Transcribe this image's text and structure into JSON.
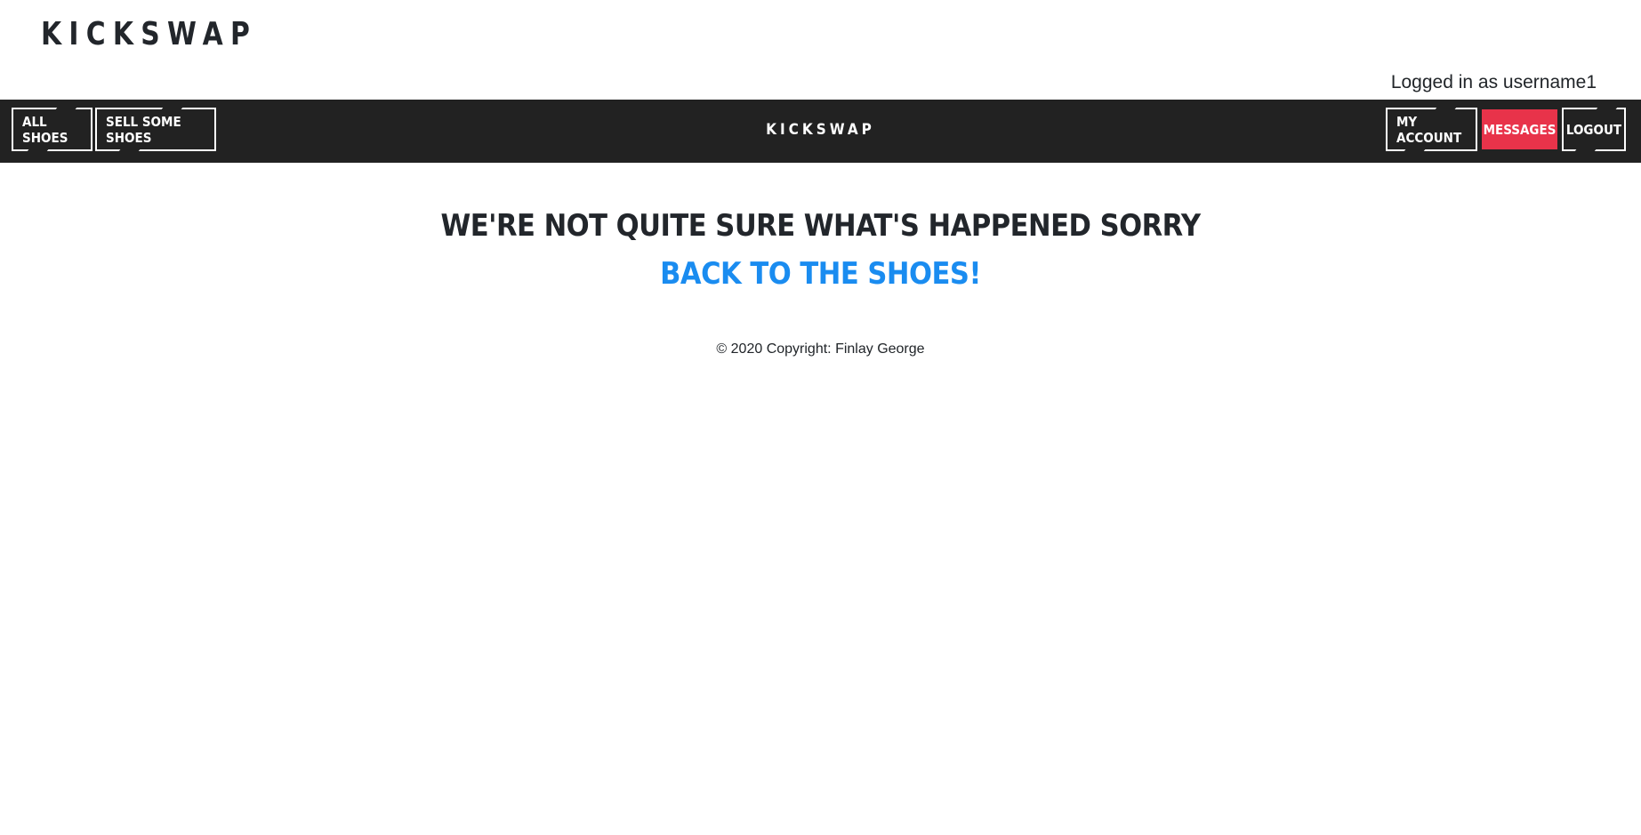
{
  "header": {
    "brand": "KICKSWAP",
    "login_status": "Logged in as username1"
  },
  "navbar": {
    "brand": "KICKSWAP",
    "left_items": [
      {
        "label": "All Shoes"
      },
      {
        "label": "Sell Some Shoes"
      }
    ],
    "right_items": [
      {
        "label": "My Account"
      },
      {
        "label": "Messages",
        "active": true
      },
      {
        "label": "Logout"
      }
    ]
  },
  "main": {
    "title": "We're not quite sure what's happened sorry",
    "back_link": "Back to the shoes!"
  },
  "footer": {
    "copyright": "© 2020 Copyright: Finlay George"
  },
  "colors": {
    "navbar_bg": "#222222",
    "active_accent": "#e8334a",
    "link_blue": "#1a8cf0",
    "text_dark": "#22262b"
  }
}
